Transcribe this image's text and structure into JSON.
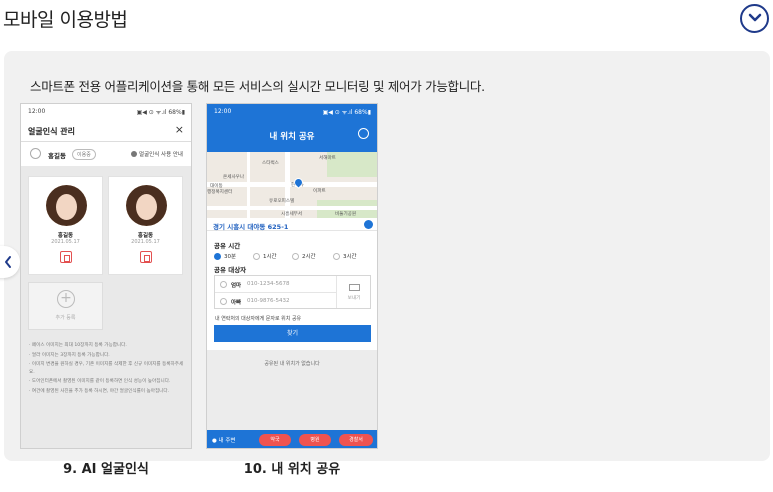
{
  "section": {
    "title": "모바일 이용방법",
    "description": "스마트폰 전용 어플리케이션을 통해 모든 서비스의 실시간 모니터링 및 제어가 가능합니다."
  },
  "screens": [
    {
      "caption": "9. AI 얼굴인식",
      "status": {
        "time": "12:00",
        "right": "▣◀ ⊙ ᯤ.ıl 68%▮"
      },
      "title": "얼굴인식 관리",
      "close": "×",
      "user": {
        "name": "홍길동",
        "badge": "이용중",
        "guide": "얼굴인식 사용 안내"
      },
      "faces": [
        {
          "name": "홍길동",
          "date": "2021.05.17"
        },
        {
          "name": "홍길동",
          "date": "2021.05.17"
        }
      ],
      "add_label": "추가 등록",
      "notes": [
        "· 페이스 이미지는 최대 10장까지 등록 가능합니다.",
        "· 얼라 이미지는 3장까지 등록 가능합니다.",
        "· 이미지 변경을 원하실 경우, 기존 이미지를 삭제한 후 신규 이미지를 등록하주세요.",
        "· 도어인터폰에서 촬영된 이미지를 같이 등록하면 인식 성능이 높아집니다.",
        "· 여건에 촬영된 사진을 추가 등록 하시면, 야간 얼굴인식률이 높아집니다."
      ]
    },
    {
      "caption": "10. 내 위치 공유",
      "status": {
        "time": "12:00",
        "right": "▣◀ ⊙ ᯤ.ıl 68%▮"
      },
      "title": "내 위치 공유",
      "map_labels": [
        "스타벅스",
        "서해마트",
        "온세사우나",
        "대이동",
        "행정복지센터",
        "한국타",
        "이파트",
        "유로오피스텔",
        "시흥세무서",
        "비둘기공원"
      ],
      "address": "경기 시흥시 대야동 625-1",
      "share_time": {
        "label": "공유 시간",
        "options": [
          "30분",
          "1시간",
          "2시간",
          "3시간"
        ],
        "selected": "30분"
      },
      "share_target": {
        "label": "공유 대상자",
        "rows": [
          {
            "name": "엄마",
            "phone": "010-1234-5678"
          },
          {
            "name": "아빠",
            "phone": "010-9876-5432"
          }
        ],
        "send_label": "보내기"
      },
      "hint": "내 연락처의 대상자에게 문자로 위치 공유",
      "find_label": "찾기",
      "empty_shared": "공유된 내 위치가 없습니다",
      "bottom": {
        "near": "● 내 주변",
        "buttons": [
          "약국",
          "병원",
          "경찰서"
        ]
      }
    }
  ],
  "colors": {
    "accent": "#1e74d6",
    "danger": "#ef5350",
    "panel": "#f1f1f1"
  },
  "icons": {
    "collapse": "chevron-down-icon",
    "prev": "chevron-left-icon"
  }
}
